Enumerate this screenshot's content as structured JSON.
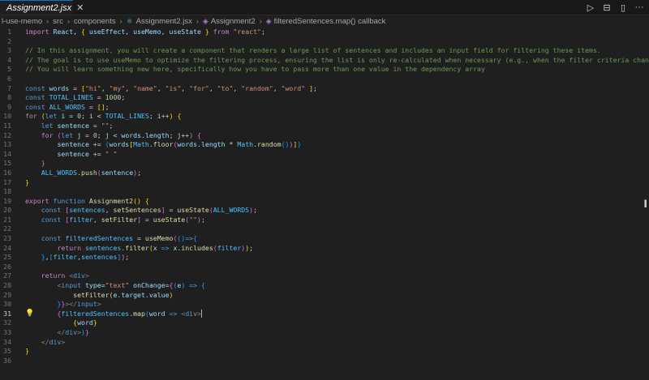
{
  "tab": {
    "title": "Assignment2.jsx",
    "close_icon": "✕"
  },
  "tab_actions": [
    "run-icon",
    "split-editor-icon",
    "more-icon"
  ],
  "breadcrumbs": {
    "items": [
      "l-use-memo",
      "src",
      "components",
      "Assignment2.jsx",
      "Assignment2",
      "filteredSentences.map() callback"
    ]
  },
  "code": {
    "active_line": 31,
    "lines": [
      "1",
      "2",
      "3",
      "4",
      "5",
      "6",
      "7",
      "8",
      "9",
      "10",
      "11",
      "12",
      "13",
      "14",
      "15",
      "16",
      "17",
      "18",
      "19",
      "20",
      "21",
      "22",
      "23",
      "24",
      "25",
      "26",
      "27",
      "28",
      "29",
      "30",
      "31",
      "32",
      "33",
      "34",
      "35",
      "36"
    ],
    "comment_1": "// In this assignment, you will create a component that renders a large list of sentences and includes an input field for filtering these items.",
    "comment_2": "// The goal is to use useMemo to optimize the filtering process, ensuring the list is only re-calculated when necessary (e.g., when the filter criteria changes).",
    "comment_3": "// You will learn something new here, specifically how you have to pass more than one value in the dependency array"
  }
}
